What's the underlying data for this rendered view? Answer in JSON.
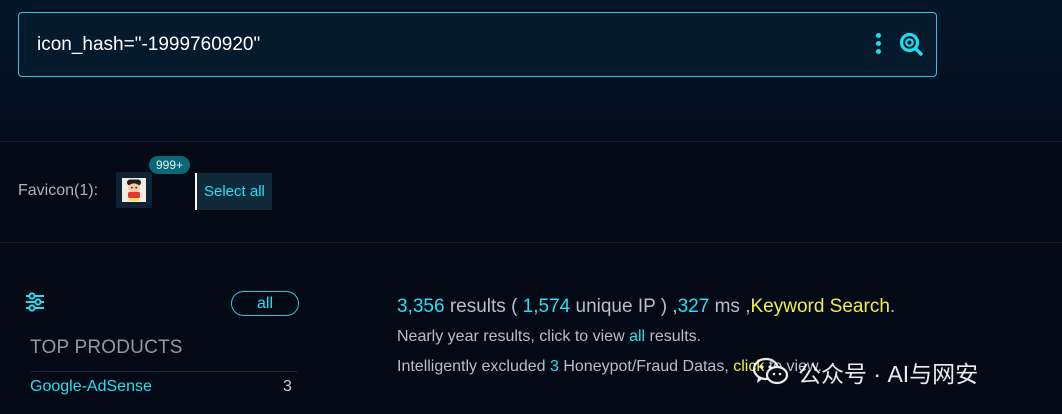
{
  "search": {
    "query": "icon_hash=\"-1999760920\"",
    "more_icon": "more-vertical-icon",
    "search_icon": "search-icon"
  },
  "favicon": {
    "label": "Favicon(1):",
    "badge": "999+",
    "select_all": "Select all"
  },
  "sidebar": {
    "filter_icon": "filter-icon",
    "all_label": "all",
    "section_title": "TOP PRODUCTS",
    "products": [
      {
        "name": "Google-AdSense",
        "count": "3"
      }
    ]
  },
  "results": {
    "total": "3,356",
    "results_word": " results ( ",
    "unique_ip": "1,574",
    "unique_ip_word": " unique IP ) ,",
    "time": "327",
    "time_unit": " ms ,",
    "keyword": "Keyword Search",
    "period": ".",
    "line2_prefix": "Nearly year results, click to view ",
    "line2_link": "all",
    "line2_suffix": " results.",
    "line3_prefix": "Intelligently excluded ",
    "line3_count": "3",
    "line3_middle": " Honeypot/Fraud Datas, ",
    "line3_link": "click",
    "line3_suffix": " to view."
  },
  "watermark": {
    "text": "公众号 · AI与网安"
  },
  "colors": {
    "accent": "#27e0f0",
    "highlight": "#f1ed4a",
    "background": "#030a16"
  }
}
